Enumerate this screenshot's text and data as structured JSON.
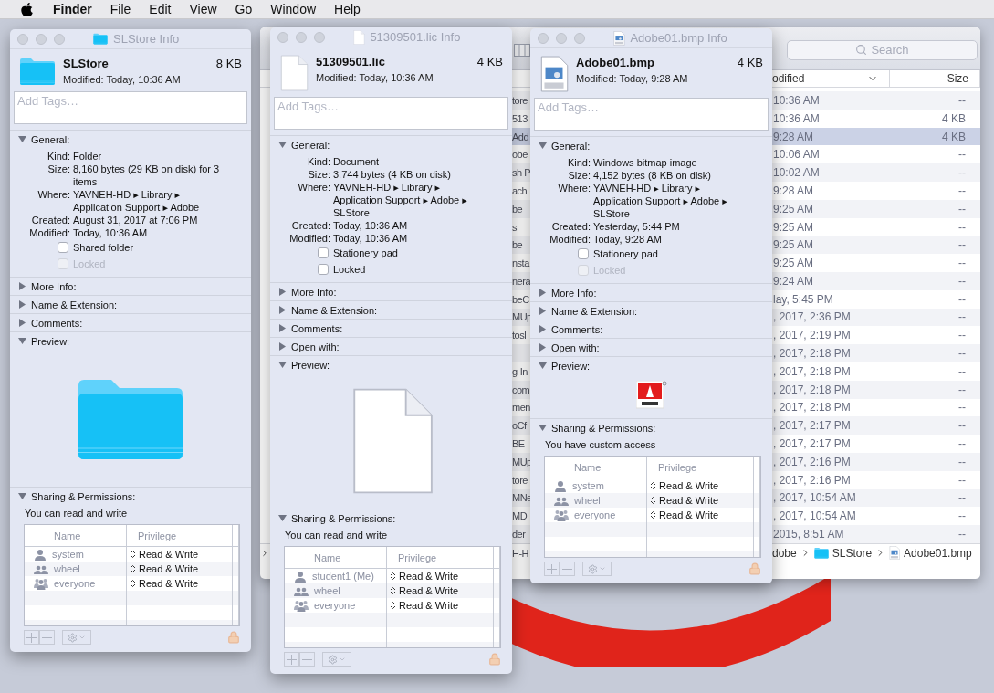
{
  "menubar": {
    "app": "Finder",
    "items": [
      "File",
      "Edit",
      "View",
      "Go",
      "Window",
      "Help"
    ]
  },
  "finder": {
    "search_placeholder": "Search",
    "columns": [
      {
        "label": "odified",
        "sorted": true
      },
      {
        "label": "Size",
        "sorted": false
      }
    ],
    "rows": [
      {
        "name": "tore",
        "modified": "10:36 AM",
        "size": "--",
        "selected": false
      },
      {
        "name": "513",
        "modified": "10:36 AM",
        "size": "4 KB",
        "selected": false
      },
      {
        "name": "Add",
        "modified": "9:28 AM",
        "size": "4 KB",
        "selected": true
      },
      {
        "name": "obe",
        "modified": "10:06 AM",
        "size": "--",
        "selected": false
      },
      {
        "name": "sh P",
        "modified": "10:02 AM",
        "size": "--",
        "selected": false
      },
      {
        "name": "ach",
        "modified": "9:28 AM",
        "size": "--",
        "selected": false
      },
      {
        "name": "be",
        "modified": "9:25 AM",
        "size": "--",
        "selected": false
      },
      {
        "name": "s",
        "modified": "9:25 AM",
        "size": "--",
        "selected": false
      },
      {
        "name": "be",
        "modified": "9:25 AM",
        "size": "--",
        "selected": false
      },
      {
        "name": "nsta",
        "modified": "9:25 AM",
        "size": "--",
        "selected": false
      },
      {
        "name": "nera",
        "modified": "9:24 AM",
        "size": "--",
        "selected": false
      },
      {
        "name": "beC",
        "modified": "lay, 5:45 PM",
        "size": "--",
        "selected": false
      },
      {
        "name": "MUp",
        "modified": ", 2017, 2:36 PM",
        "size": "--",
        "selected": false
      },
      {
        "name": "tosl",
        "modified": ", 2017, 2:19 PM",
        "size": "--",
        "selected": false
      },
      {
        "modified": ", 2017, 2:18 PM",
        "size": "--",
        "selected": false
      },
      {
        "name": "g-In",
        "modified": ", 2017, 2:18 PM",
        "size": "--",
        "selected": false
      },
      {
        "name": "com",
        "modified": ", 2017, 2:18 PM",
        "size": "--",
        "selected": false
      },
      {
        "name": "men",
        "modified": ", 2017, 2:18 PM",
        "size": "--",
        "selected": false
      },
      {
        "name": "oCf",
        "modified": ", 2017, 2:17 PM",
        "size": "--",
        "selected": false
      },
      {
        "name": "BE",
        "modified": ", 2017, 2:17 PM",
        "size": "--",
        "selected": false
      },
      {
        "name": "MUp",
        "modified": ", 2017, 2:16 PM",
        "size": "--",
        "selected": false
      },
      {
        "name": "tore",
        "modified": ", 2017, 2:16 PM",
        "size": "--",
        "selected": false
      },
      {
        "name": "MNe",
        "modified": ", 2017, 10:54 AM",
        "size": "--",
        "selected": false
      },
      {
        "name": "MD",
        "modified": ", 2017, 10:54 AM",
        "size": "--",
        "selected": false
      },
      {
        "name": "der",
        "modified": " 2015, 8:51 AM",
        "size": "--",
        "selected": false
      }
    ],
    "path": {
      "fragment": "H-H",
      "items": [
        {
          "kind": "text",
          "label": "dobe"
        },
        {
          "kind": "folder",
          "label": "SLStore"
        },
        {
          "kind": "bmp",
          "label": "Adobe01.bmp"
        }
      ]
    }
  },
  "windows": [
    {
      "title": "SLStore Info",
      "kind": "folder",
      "name": "SLStore",
      "size": "8 KB",
      "modified": "Modified: Today, 10:36 AM",
      "tags_placeholder": "Add Tags…",
      "sections": [
        {
          "kind": "general",
          "title": "General:",
          "expanded": true,
          "fields": [
            {
              "label": "Kind:",
              "value": "Folder"
            },
            {
              "label": "Size:",
              "value": "8,160 bytes (29 KB on disk) for 3\nitems"
            },
            {
              "label": "Where:",
              "value": "YAVNEH-HD ▸ Library ▸\nApplication Support ▸ Adobe"
            },
            {
              "label": "Created:",
              "value": "August 31, 2017 at 7:06 PM"
            },
            {
              "label": "Modified:",
              "value": "Today, 10:36 AM"
            }
          ],
          "checkboxes": [
            {
              "label": "Shared folder",
              "checked": false,
              "disabled": false
            },
            {
              "label": "Locked",
              "checked": false,
              "disabled": true
            }
          ]
        },
        {
          "kind": "info",
          "title": "More Info:",
          "expanded": false
        },
        {
          "kind": "info",
          "title": "Name & Extension:",
          "expanded": false
        },
        {
          "kind": "info",
          "title": "Comments:",
          "expanded": false
        },
        {
          "kind": "preview",
          "title": "Preview:",
          "expanded": true
        },
        {
          "kind": "sharing",
          "title": "Sharing & Permissions:",
          "expanded": true,
          "access": "You can read and write",
          "columns": [
            "Name",
            "Privilege"
          ],
          "rows": [
            {
              "kind": "user",
              "name": "system",
              "privilege": "Read & Write"
            },
            {
              "kind": "group",
              "name": "wheel",
              "privilege": "Read & Write"
            },
            {
              "kind": "everyone",
              "name": "everyone",
              "privilege": "Read & Write"
            }
          ]
        }
      ]
    },
    {
      "title": "51309501.lic Info",
      "kind": "document",
      "name": "51309501.lic",
      "size": "4 KB",
      "modified": "Modified: Today, 10:36 AM",
      "tags_placeholder": "Add Tags…",
      "sections": [
        {
          "kind": "general",
          "title": "General:",
          "expanded": true,
          "fields": [
            {
              "label": "Kind:",
              "value": "Document"
            },
            {
              "label": "Size:",
              "value": "3,744 bytes (4 KB on disk)"
            },
            {
              "label": "Where:",
              "value": "YAVNEH-HD ▸ Library ▸\nApplication Support ▸ Adobe ▸\nSLStore"
            },
            {
              "label": "Created:",
              "value": "Today, 10:36 AM"
            },
            {
              "label": "Modified:",
              "value": "Today, 10:36 AM"
            }
          ],
          "checkboxes": [
            {
              "label": "Stationery pad",
              "checked": false,
              "disabled": false
            },
            {
              "label": "Locked",
              "checked": false,
              "disabled": false
            }
          ]
        },
        {
          "kind": "info",
          "title": "More Info:",
          "expanded": false
        },
        {
          "kind": "info",
          "title": "Name & Extension:",
          "expanded": false
        },
        {
          "kind": "info",
          "title": "Comments:",
          "expanded": false
        },
        {
          "kind": "info",
          "title": "Open with:",
          "expanded": false
        },
        {
          "kind": "preview",
          "title": "Preview:",
          "expanded": true
        },
        {
          "kind": "sharing",
          "title": "Sharing & Permissions:",
          "expanded": true,
          "access": "You can read and write",
          "columns": [
            "Name",
            "Privilege"
          ],
          "rows": [
            {
              "kind": "user",
              "name": "student1 (Me)",
              "privilege": "Read & Write"
            },
            {
              "kind": "group",
              "name": "wheel",
              "privilege": "Read & Write"
            },
            {
              "kind": "everyone",
              "name": "everyone",
              "privilege": "Read & Write"
            }
          ]
        }
      ]
    },
    {
      "title": "Adobe01.bmp Info",
      "kind": "bmp",
      "name": "Adobe01.bmp",
      "size": "4 KB",
      "modified": "Modified: Today, 9:28 AM",
      "tags_placeholder": "Add Tags…",
      "sections": [
        {
          "kind": "general",
          "title": "General:",
          "expanded": true,
          "fields": [
            {
              "label": "Kind:",
              "value": "Windows bitmap image"
            },
            {
              "label": "Size:",
              "value": "4,152 bytes (8 KB on disk)"
            },
            {
              "label": "Where:",
              "value": "YAVNEH-HD ▸ Library ▸\nApplication Support ▸ Adobe ▸\nSLStore"
            },
            {
              "label": "Created:",
              "value": "Yesterday, 5:44 PM"
            },
            {
              "label": "Modified:",
              "value": "Today, 9:28 AM"
            }
          ],
          "checkboxes": [
            {
              "label": "Stationery pad",
              "checked": false,
              "disabled": false
            },
            {
              "label": "Locked",
              "checked": false,
              "disabled": true
            }
          ]
        },
        {
          "kind": "info",
          "title": "More Info:",
          "expanded": false
        },
        {
          "kind": "info",
          "title": "Name & Extension:",
          "expanded": false
        },
        {
          "kind": "info",
          "title": "Comments:",
          "expanded": false
        },
        {
          "kind": "info",
          "title": "Open with:",
          "expanded": false
        },
        {
          "kind": "preview",
          "title": "Preview:",
          "expanded": true
        },
        {
          "kind": "sharing",
          "title": "Sharing & Permissions:",
          "expanded": true,
          "access": "You have custom access",
          "columns": [
            "Name",
            "Privilege"
          ],
          "rows": [
            {
              "kind": "user",
              "name": "system",
              "privilege": "Read & Write"
            },
            {
              "kind": "group",
              "name": "wheel",
              "privilege": "Read & Write"
            },
            {
              "kind": "everyone",
              "name": "everyone",
              "privilege": "Read & Write"
            }
          ]
        }
      ]
    }
  ]
}
